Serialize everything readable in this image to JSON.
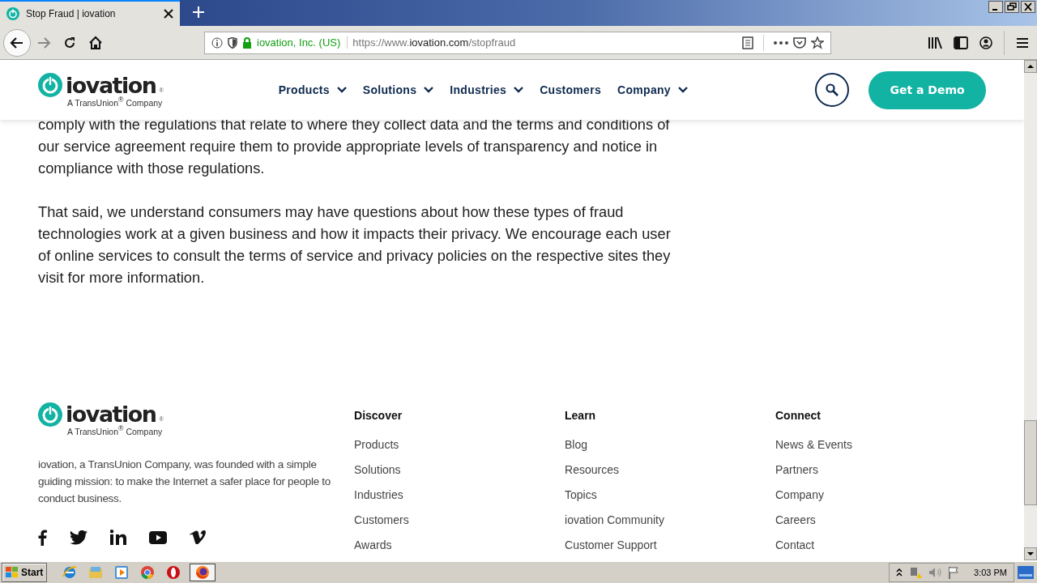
{
  "browser": {
    "tabs": [
      {
        "title": "Stop Fraud | iovation",
        "selected": true
      }
    ],
    "identity": "iovation, Inc. (US)",
    "url_prefix": "https://www.",
    "url_host": "iovation.com",
    "url_path": "/stopfraud"
  },
  "header": {
    "logo": {
      "wordmark": "iovation",
      "mark": "®",
      "tagline": "A TransUnion$^{®}$ Company"
    },
    "nav": [
      {
        "label": "Products",
        "has_menu": true
      },
      {
        "label": "Solutions",
        "has_menu": true
      },
      {
        "label": "Industries",
        "has_menu": true
      },
      {
        "label": "Customers",
        "has_menu": false
      },
      {
        "label": "Company",
        "has_menu": true
      }
    ],
    "cta": "Get a Demo"
  },
  "article": {
    "paragraphs": [
      "comply with the regulations that relate to where they collect data and the terms and conditions of our service agreement require them to provide appropriate levels of transparency and notice in compliance with those regulations.",
      "That said, we understand consumers may have questions about how these types of fraud technologies work at a given business and how it impacts their privacy. We encourage each user of online services to consult the terms of service and privacy policies on the respective sites they visit for more information."
    ]
  },
  "footer": {
    "logo": {
      "wordmark": "iovation",
      "mark": "®",
      "tagline": "A TransUnion$^{®}$ Company"
    },
    "about": "iovation, a TransUnion Company, was founded with a simple guiding mission: to make the Internet a safer place for people to conduct business.",
    "social": [
      {
        "kind": "facebook"
      },
      {
        "kind": "twitter"
      },
      {
        "kind": "linkedin"
      },
      {
        "kind": "youtube"
      },
      {
        "kind": "vimeo"
      }
    ],
    "columns": [
      {
        "heading": "Discover",
        "links": [
          "Products",
          "Solutions",
          "Industries",
          "Customers",
          "Awards"
        ]
      },
      {
        "heading": "Learn",
        "links": [
          "Blog",
          "Resources",
          "Topics",
          "iovation Community",
          "Customer Support"
        ]
      },
      {
        "heading": "Connect",
        "links": [
          "News & Events",
          "Partners",
          "Company",
          "Careers",
          "Contact"
        ]
      }
    ]
  },
  "taskbar": {
    "start": "Start",
    "apps": [
      {
        "kind": "ie",
        "selected": false
      },
      {
        "kind": "explorer",
        "selected": false
      },
      {
        "kind": "media",
        "selected": false
      },
      {
        "kind": "chrome",
        "selected": false
      },
      {
        "kind": "opera",
        "selected": false
      },
      {
        "kind": "firefox",
        "selected": true
      }
    ],
    "time": "3:03 PM"
  }
}
